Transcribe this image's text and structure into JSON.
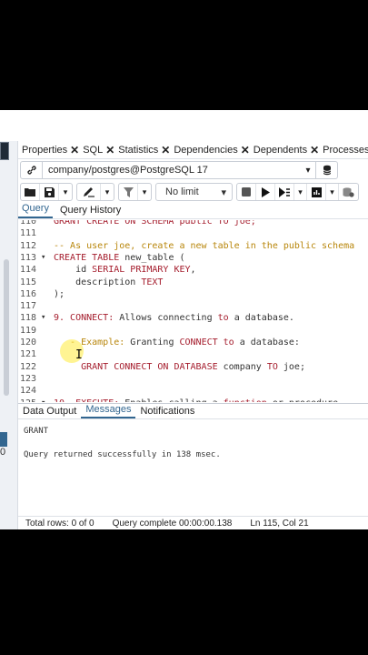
{
  "tabs": [
    {
      "label": "Properties"
    },
    {
      "label": "SQL"
    },
    {
      "label": "Statistics"
    },
    {
      "label": "Dependencies"
    },
    {
      "label": "Dependents"
    },
    {
      "label": "Processes"
    }
  ],
  "connection": {
    "label": "company/postgres@PostgreSQL 17"
  },
  "toolbar": {
    "limit_label": "No limit"
  },
  "editor_tabs": {
    "query": "Query",
    "history": "Query History"
  },
  "editor": {
    "lines": [
      {
        "n": "110",
        "parts": [
          {
            "t": "GRANT CREATE ON SCHEMA public TO joe;",
            "c": "kw"
          }
        ]
      },
      {
        "n": "111",
        "parts": []
      },
      {
        "n": "112",
        "parts": [
          {
            "t": "-- As user joe, create a new table in the public schema",
            "c": "cm"
          }
        ]
      },
      {
        "n": "113",
        "fold": "▾",
        "parts": [
          {
            "t": "CREATE TABLE ",
            "c": "kw"
          },
          {
            "t": "new_table (",
            "c": "pl"
          }
        ]
      },
      {
        "n": "114",
        "parts": [
          {
            "t": "    id ",
            "c": "pl"
          },
          {
            "t": "SERIAL PRIMARY KEY",
            "c": "kw"
          },
          {
            "t": ",",
            "c": "pl"
          }
        ]
      },
      {
        "n": "115",
        "parts": [
          {
            "t": "    description ",
            "c": "pl"
          },
          {
            "t": "TEXT",
            "c": "kw"
          }
        ]
      },
      {
        "n": "116",
        "parts": [
          {
            "t": ");",
            "c": "pl"
          }
        ]
      },
      {
        "n": "117",
        "parts": []
      },
      {
        "n": "118",
        "fold": "▾",
        "parts": [
          {
            "t": "9. CONNECT: ",
            "c": "kw"
          },
          {
            "t": "Allows connecting ",
            "c": "pl"
          },
          {
            "t": "to",
            "c": "kw"
          },
          {
            "t": " a database.",
            "c": "pl"
          }
        ]
      },
      {
        "n": "119",
        "parts": []
      },
      {
        "n": "120",
        "parts": [
          {
            "t": "   - Example: ",
            "c": "cm"
          },
          {
            "t": "Granting ",
            "c": "pl"
          },
          {
            "t": "CONNECT to",
            "c": "kw"
          },
          {
            "t": " a database:",
            "c": "pl"
          }
        ]
      },
      {
        "n": "121",
        "parts": []
      },
      {
        "n": "122",
        "parts": [
          {
            "t": "     GRANT CONNECT ON DATABASE ",
            "c": "kw"
          },
          {
            "t": "company ",
            "c": "pl"
          },
          {
            "t": "TO",
            "c": "kw"
          },
          {
            "t": " joe;",
            "c": "pl"
          }
        ]
      },
      {
        "n": "123",
        "parts": []
      },
      {
        "n": "124",
        "parts": []
      },
      {
        "n": "125",
        "fold": "▾",
        "parts": [
          {
            "t": "10. EXECUTE: ",
            "c": "kw"
          },
          {
            "t": "Enables calling a ",
            "c": "pl"
          },
          {
            "t": "function",
            "c": "kw"
          },
          {
            "t": " or procedure.",
            "c": "pl"
          }
        ]
      }
    ]
  },
  "results": {
    "tabs": [
      {
        "label": "Data Output"
      },
      {
        "label": "Messages"
      },
      {
        "label": "Notifications"
      }
    ],
    "message_title": "GRANT",
    "message_body": "Query returned successfully in 138 msec."
  },
  "status": {
    "rows": "Total rows: 0 of 0",
    "query": "Query complete 00:00:00.138",
    "position": "Ln 115, Col 21"
  },
  "left_panel": {
    "digit": "0"
  },
  "colors": {
    "accent": "#326690",
    "keyword": "#a51d2d",
    "comment": "#b8860b"
  }
}
